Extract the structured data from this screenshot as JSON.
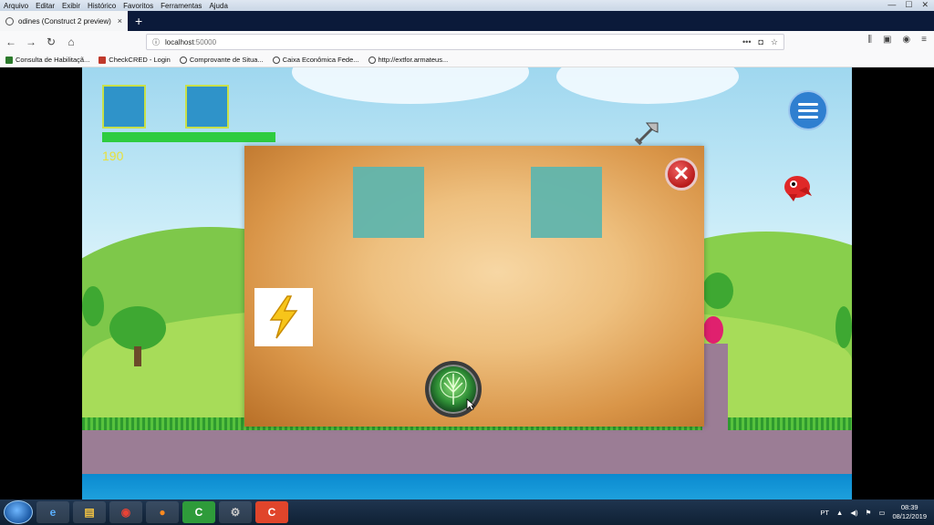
{
  "browser": {
    "menu": [
      "Arquivo",
      "Editar",
      "Exibir",
      "Histórico",
      "Favoritos",
      "Ferramentas",
      "Ajuda"
    ],
    "tab_title": "odines (Construct 2 preview)",
    "tab_close": "×",
    "new_tab": "+",
    "url_host": "localhost",
    "url_port": ":50000",
    "bookmarks": [
      "Consulta de Habilitaçã...",
      "CheckCRED - Login",
      "Comprovante de Situa...",
      "Caixa Econômica Fede...",
      "http://extfor.armateus..."
    ]
  },
  "game": {
    "score": "190",
    "hp_fraction": 1.0,
    "dialog_close": "✕",
    "icons": {
      "axe": "axe-icon",
      "enemy": "red-bird-enemy",
      "bolt": "lightning-bolt-icon",
      "tree_orb": "tree-of-life-orb",
      "menu": "hamburger-menu-icon"
    }
  },
  "taskbar": {
    "apps": [
      "ie",
      "explorer",
      "chrome",
      "firefox",
      "camtasia",
      "settings",
      "construct"
    ],
    "lang": "PT",
    "time": "08:39",
    "date": "08/12/2019"
  },
  "colors": {
    "sky": "#9fd7ef",
    "hp": "#2ecc40",
    "score": "#e8e03a",
    "slot": "#2f93c9",
    "dialog_slot": "#60b5ad",
    "ground": "#9b7d95"
  }
}
